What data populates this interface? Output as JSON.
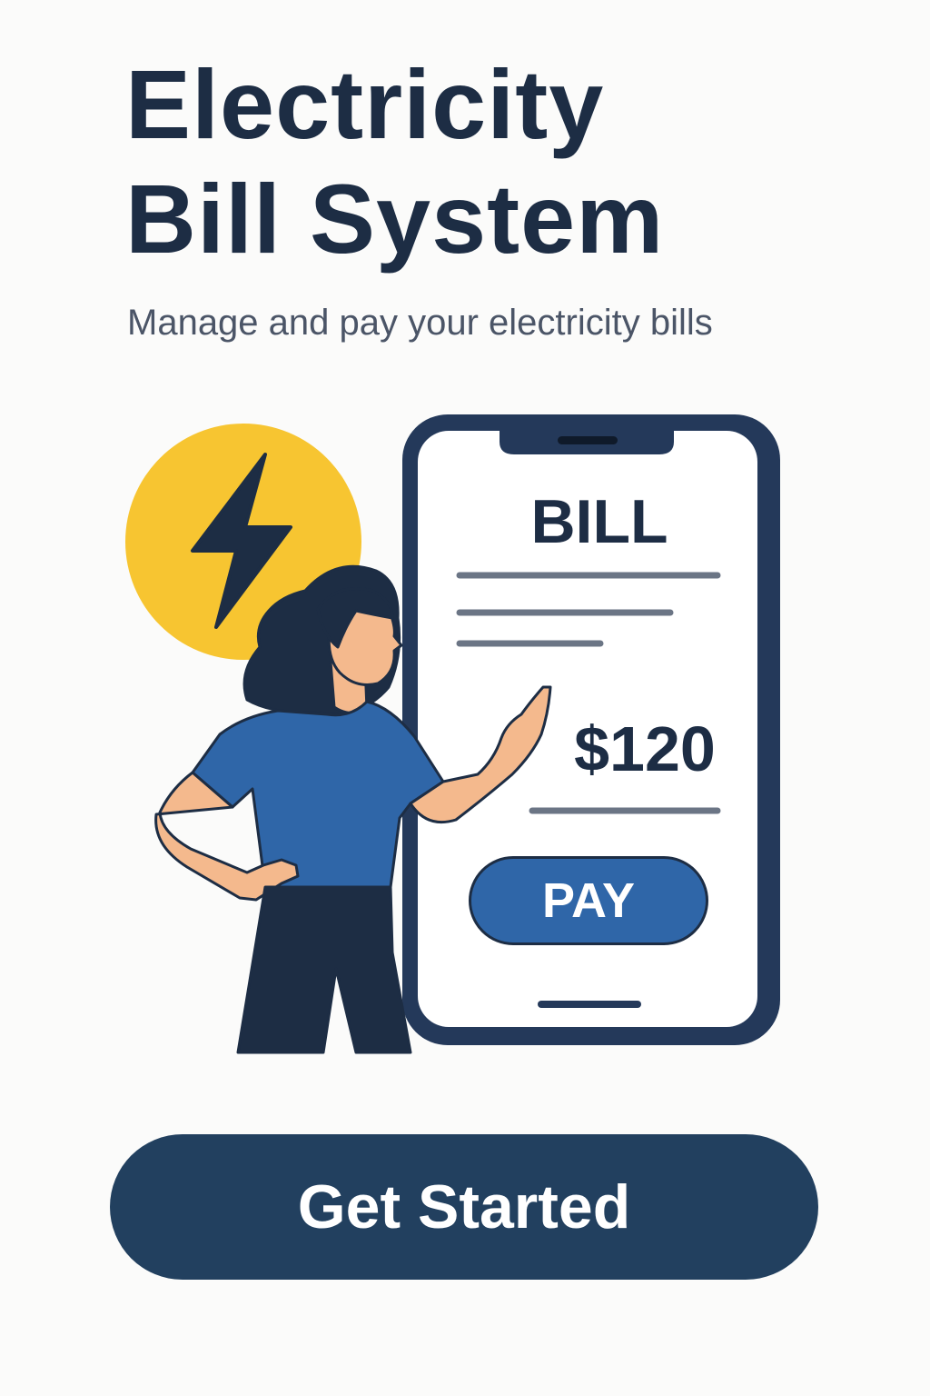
{
  "header": {
    "title_line1": "Electricity",
    "title_line2": "Bill System",
    "subtitle": "Manage and pay your electricity bills"
  },
  "phone": {
    "bill_label": "BILL",
    "amount": "$120",
    "pay_label": "PAY"
  },
  "cta": {
    "label": "Get Started"
  },
  "icons": {
    "badge": "lightning-bolt-icon"
  },
  "colors": {
    "primary_dark": "#22405f",
    "text_dark": "#1d2d44",
    "accent_yellow": "#f7c531",
    "accent_blue": "#2f66a8",
    "background": "#fbfbfa"
  }
}
